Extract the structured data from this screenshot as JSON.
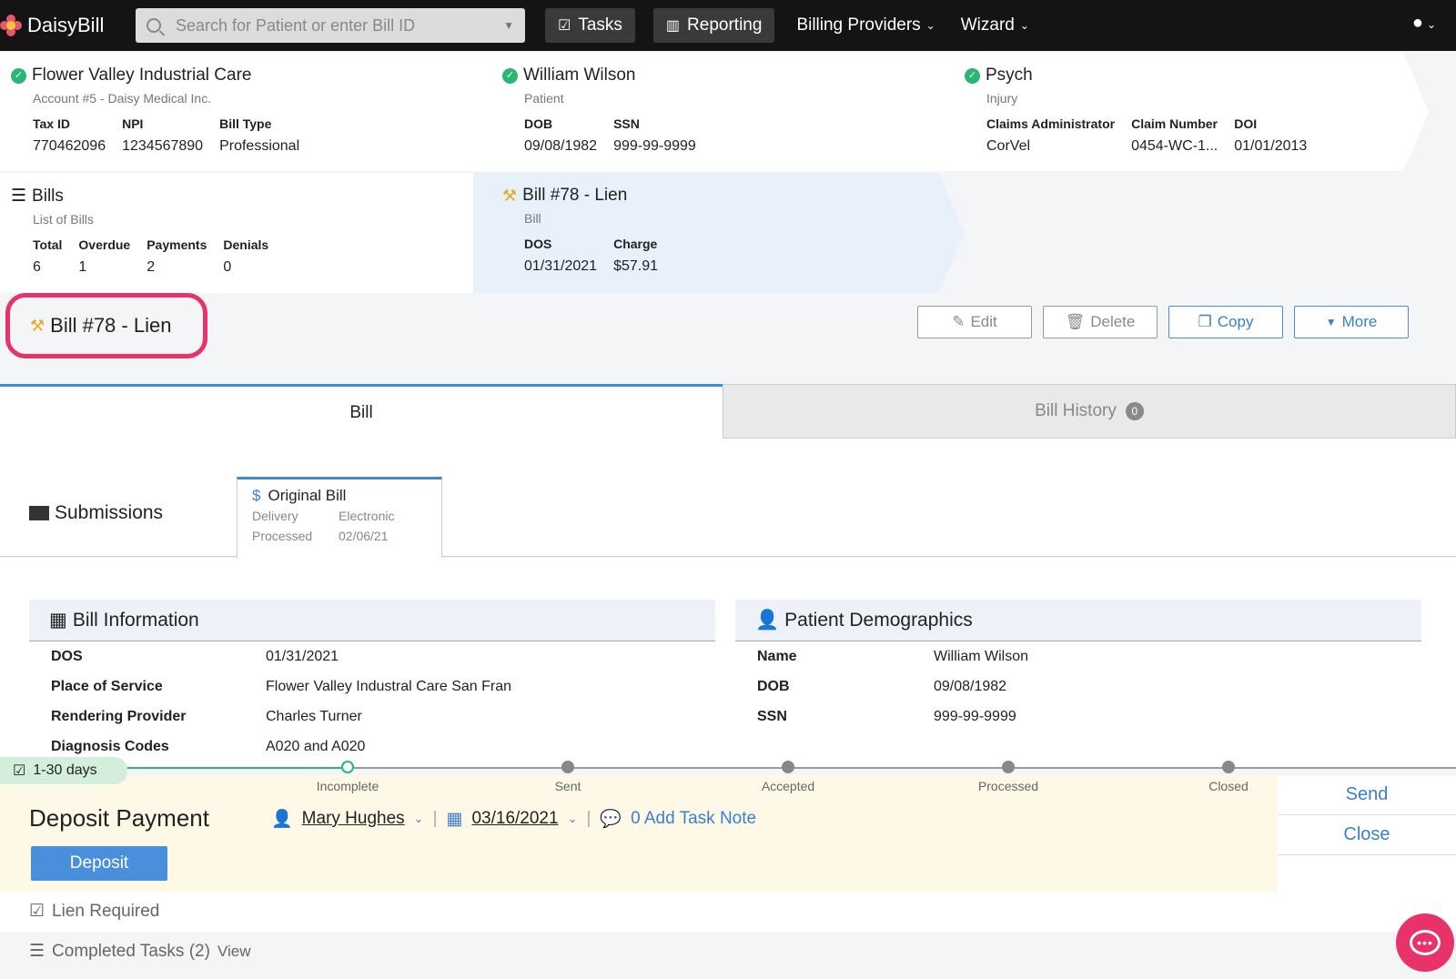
{
  "nav": {
    "brand": "DaisyBill",
    "search_placeholder": "Search for Patient or enter Bill ID",
    "tasks": "Tasks",
    "reporting": "Reporting",
    "billing_providers": "Billing Providers",
    "wizard": "Wizard"
  },
  "account": {
    "title": "Flower Valley Industrial Care",
    "sub": "Account #5 - Daisy Medical Inc.",
    "fields": [
      {
        "k": "Tax ID",
        "v": "770462096"
      },
      {
        "k": "NPI",
        "v": "1234567890"
      },
      {
        "k": "Bill Type",
        "v": "Professional"
      }
    ]
  },
  "patient": {
    "title": "William Wilson",
    "sub": "Patient",
    "fields": [
      {
        "k": "DOB",
        "v": "09/08/1982"
      },
      {
        "k": "SSN",
        "v": "999-99-9999"
      }
    ]
  },
  "injury": {
    "title": "Psych",
    "sub": "Injury",
    "fields": [
      {
        "k": "Claims Administrator",
        "v": "CorVel"
      },
      {
        "k": "Claim Number",
        "v": "0454-WC-1..."
      },
      {
        "k": "DOI",
        "v": "01/01/2013"
      }
    ]
  },
  "bills": {
    "title": "Bills",
    "sub": "List of Bills",
    "fields": [
      {
        "k": "Total",
        "v": "6"
      },
      {
        "k": "Overdue",
        "v": "1"
      },
      {
        "k": "Payments",
        "v": "2"
      },
      {
        "k": "Denials",
        "v": "0"
      }
    ]
  },
  "bill": {
    "title": "Bill #78 - Lien",
    "sub": "Bill",
    "fields": [
      {
        "k": "DOS",
        "v": "01/31/2021"
      },
      {
        "k": "Charge",
        "v": "$57.91"
      }
    ]
  },
  "page_title": "Bill #78 - Lien",
  "actions": {
    "edit": "Edit",
    "delete": "Delete",
    "copy": "Copy",
    "more": "More"
  },
  "tabs": {
    "bill": "Bill",
    "history": "Bill History",
    "history_count": "0"
  },
  "submissions": {
    "label": "Submissions",
    "original_title": "Original Bill",
    "delivery_k": "Delivery",
    "delivery_v": "Electronic",
    "processed_k": "Processed",
    "processed_v": "02/06/21"
  },
  "bill_info": {
    "title": "Bill Information",
    "rows": [
      {
        "k": "DOS",
        "v": "01/31/2021"
      },
      {
        "k": "Place of Service",
        "v": "Flower Valley Industral Care San Fran"
      },
      {
        "k": "Rendering Provider",
        "v": "Charles Turner"
      },
      {
        "k": "Diagnosis Codes",
        "v": "A020 and A020"
      }
    ]
  },
  "demographics": {
    "title": "Patient Demographics",
    "rows": [
      {
        "k": "Name",
        "v": "William Wilson"
      },
      {
        "k": "DOB",
        "v": "09/08/1982"
      },
      {
        "k": "SSN",
        "v": "999-99-9999"
      }
    ]
  },
  "task": {
    "age": "1-30 days",
    "stages": [
      "Incomplete",
      "Sent",
      "Accepted",
      "Processed",
      "Closed"
    ],
    "title": "Deposit Payment",
    "assignee": "Mary Hughes",
    "date": "03/16/2021",
    "note": "0 Add Task Note",
    "deposit": "Deposit",
    "send": "Send",
    "close": "Close"
  },
  "lien_required": "Lien Required",
  "completed_tasks": "Completed Tasks (2)",
  "view": "View",
  "colors": {
    "accent": "#4a8fdc",
    "highlight": "#e8336a",
    "success": "#2bb673"
  }
}
